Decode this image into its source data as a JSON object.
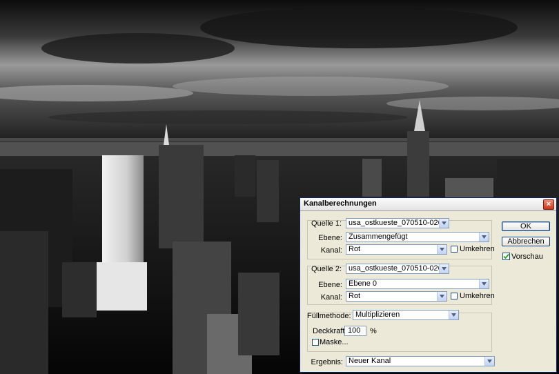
{
  "dialog": {
    "title": "Kanalberechnungen",
    "close_glyph": "×",
    "source1": {
      "label": "Quelle 1:",
      "file": "usa_ostkueste_070510-0269...",
      "layer_label": "Ebene:",
      "layer": "Zusammengefügt",
      "channel_label": "Kanal:",
      "channel": "Rot",
      "invert_label": "Umkehren",
      "invert_checked": false
    },
    "source2": {
      "label": "Quelle 2:",
      "file": "usa_ostkueste_070510-0269...",
      "layer_label": "Ebene:",
      "layer": "Ebene 0",
      "channel_label": "Kanal:",
      "channel": "Rot",
      "invert_label": "Umkehren",
      "invert_checked": false
    },
    "blend": {
      "mode_label": "Füllmethode:",
      "mode": "Multiplizieren",
      "opacity_label": "Deckkraft:",
      "opacity": "100",
      "opacity_unit": "%",
      "mask_label": "Maske...",
      "mask_checked": false
    },
    "result": {
      "label": "Ergebnis:",
      "value": "Neuer Kanal"
    },
    "buttons": {
      "ok": "OK",
      "cancel": "Abbrechen"
    },
    "preview": {
      "label": "Vorschau",
      "checked": true
    }
  },
  "colors": {
    "dialog_bg": "#ece9d8",
    "border": "#0a246a",
    "checkmark": "#21a121"
  }
}
